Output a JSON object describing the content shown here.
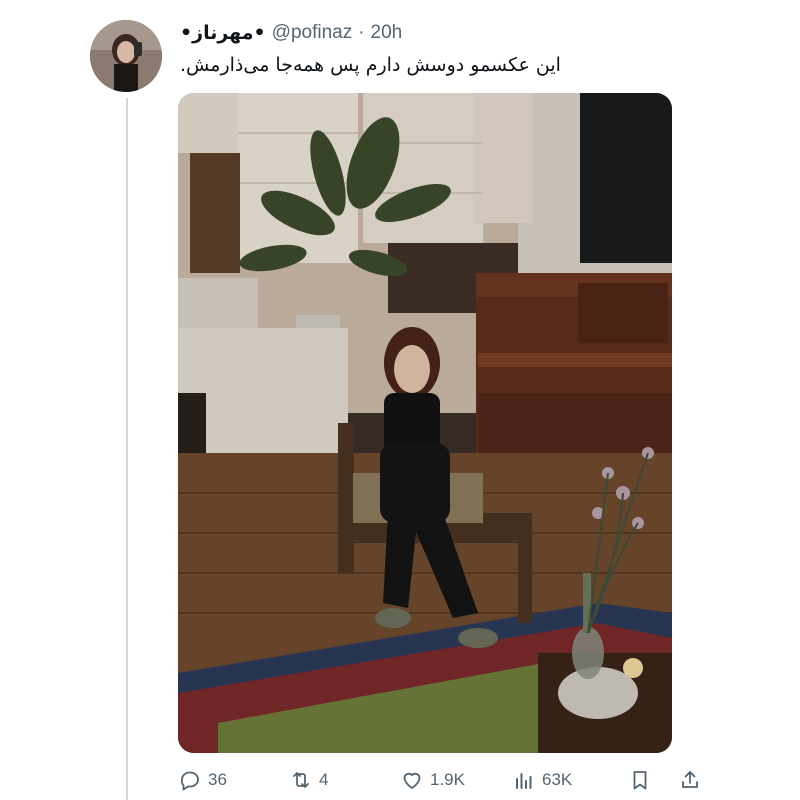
{
  "tweet": {
    "display_name": "•مهرناز•",
    "handle": "@pofinaz",
    "separator": "·",
    "time": "20h",
    "text": "این عکسمو دوسش دارم پس همه‌جا می‌ذارمش."
  },
  "actions": {
    "reply": {
      "icon": "reply-icon",
      "count": "36"
    },
    "retweet": {
      "icon": "retweet-icon",
      "count": "4"
    },
    "like": {
      "icon": "heart-icon",
      "count": "1.9K"
    },
    "views": {
      "icon": "views-icon",
      "count": "63K"
    },
    "bookmark": {
      "icon": "bookmark-icon"
    },
    "share": {
      "icon": "share-icon"
    }
  },
  "colors": {
    "text_primary": "#0f1419",
    "text_secondary": "#536471",
    "thread_line": "#cfd9de"
  }
}
